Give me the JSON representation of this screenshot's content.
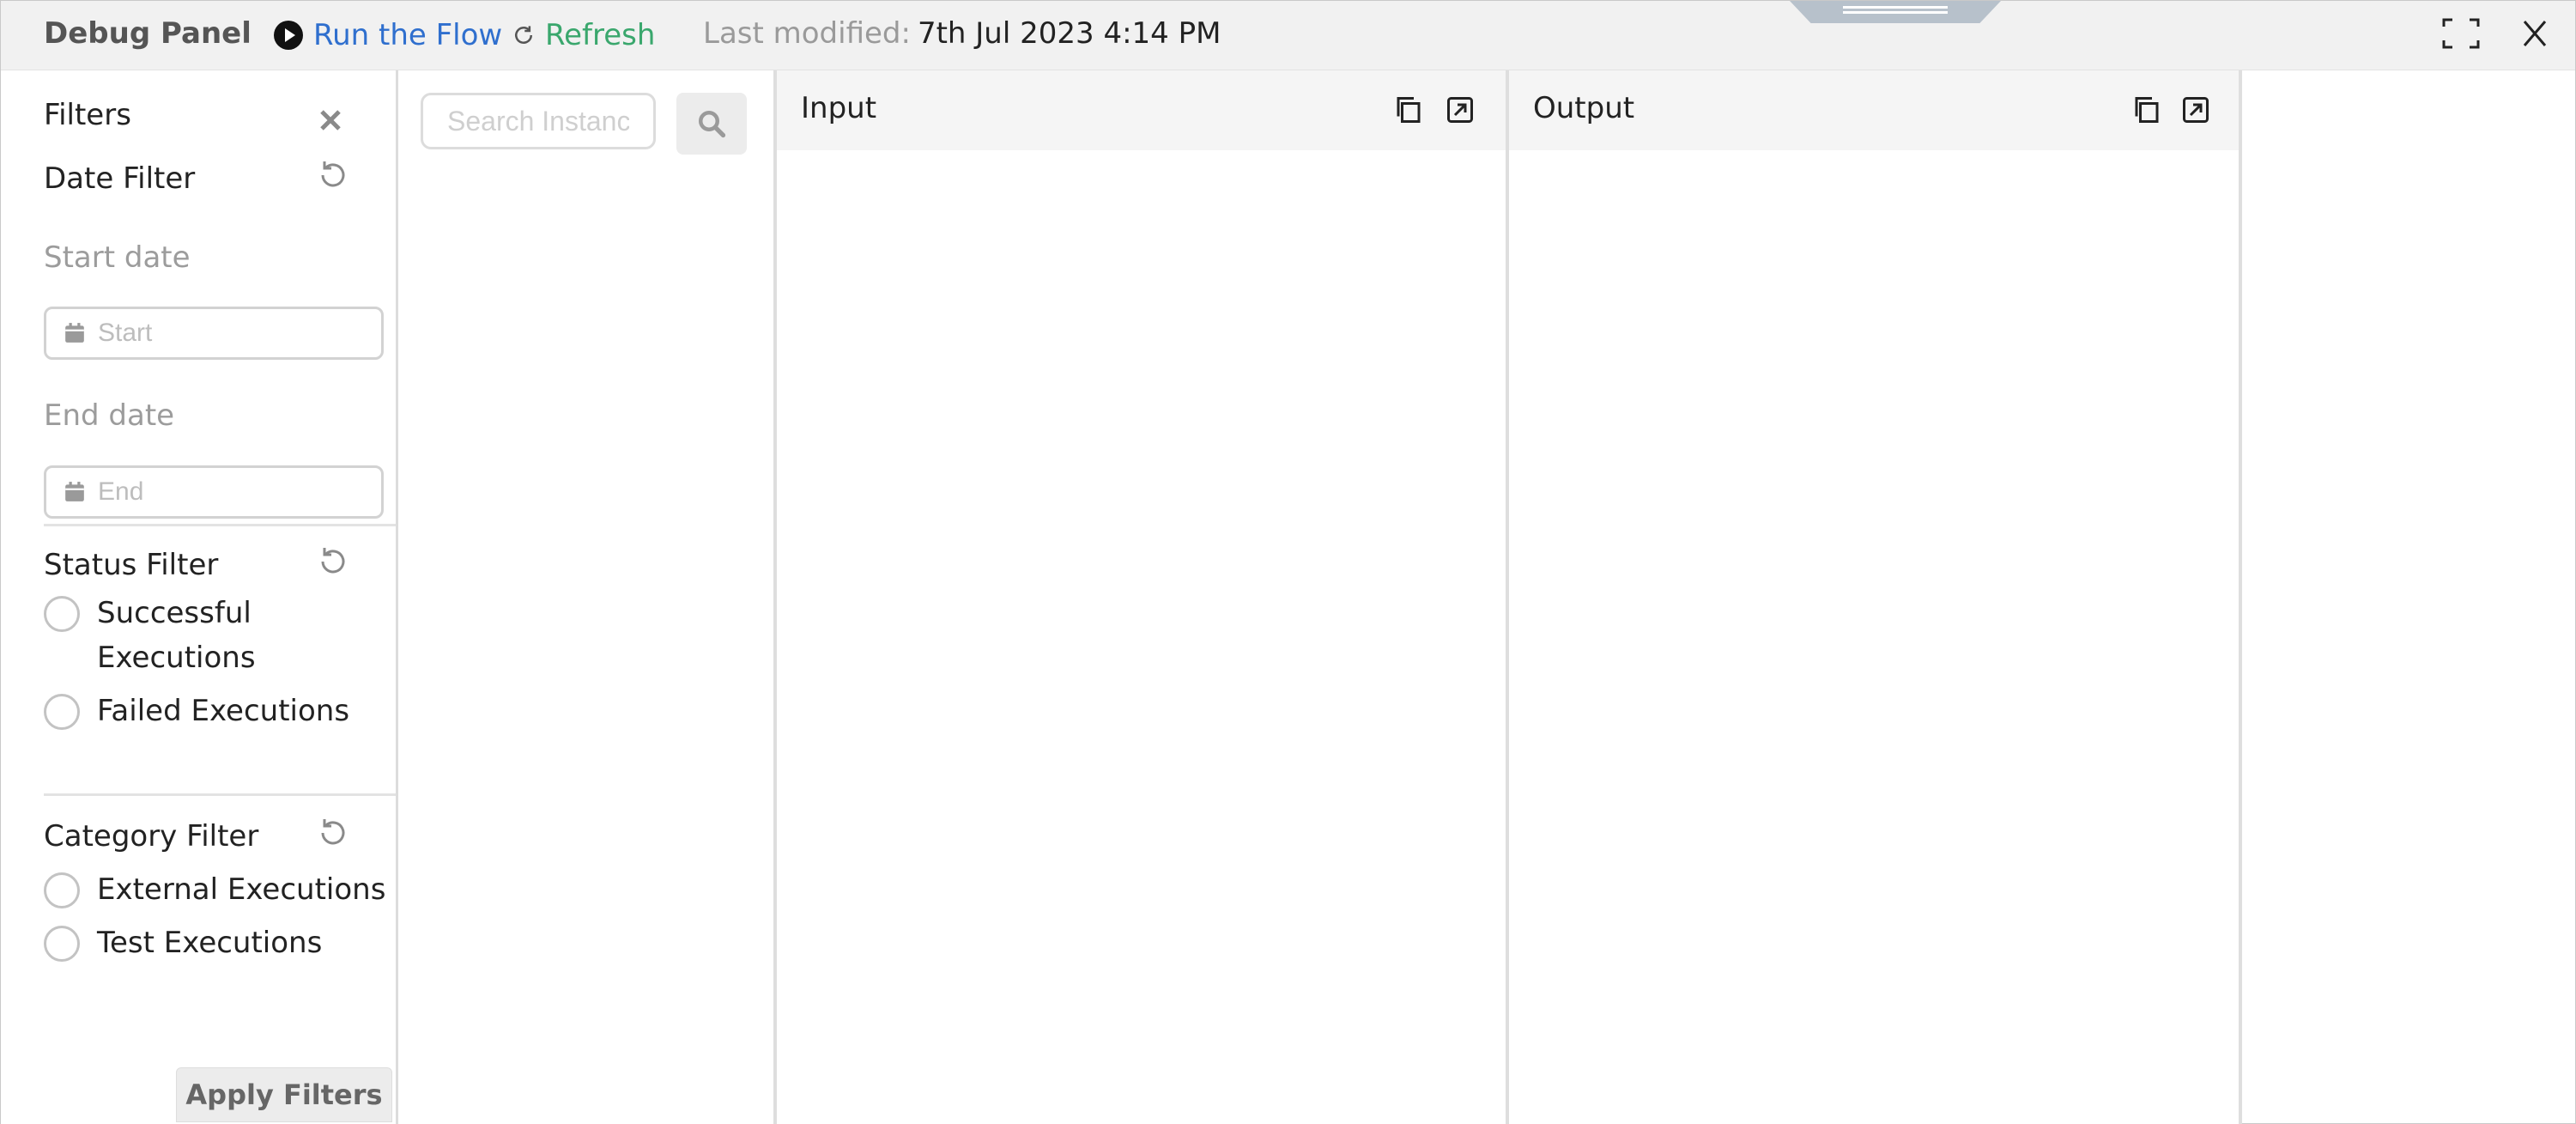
{
  "header": {
    "title": "Debug Panel",
    "run_label": "Run the Flow",
    "refresh_label": "Refresh",
    "last_modified_label": "Last modified:",
    "last_modified_value": "7th Jul 2023 4:14 PM"
  },
  "sidebar": {
    "title": "Filters",
    "date_filter": {
      "title": "Date Filter",
      "start_label": "Start date",
      "start_placeholder": "Start",
      "end_label": "End date",
      "end_placeholder": "End"
    },
    "status_filter": {
      "title": "Status Filter",
      "options": [
        "Successful Executions",
        "Failed Executions"
      ]
    },
    "category_filter": {
      "title": "Category Filter",
      "options": [
        "External Executions",
        "Test Executions"
      ]
    },
    "apply_label": "Apply Filters"
  },
  "search": {
    "placeholder": "Search Instances"
  },
  "panes": {
    "input_title": "Input",
    "output_title": "Output"
  },
  "colors": {
    "run_link": "#2f6fce",
    "refresh_link": "#3aa76d",
    "header_bg": "#f1f1f1",
    "muted_text": "#9a9a9a"
  },
  "icons": {
    "run": "play-circle-icon",
    "refresh": "refresh-icon",
    "fullscreen": "fullscreen-icon",
    "close": "close-icon",
    "reset": "reset-icon",
    "calendar": "calendar-icon",
    "search": "search-icon",
    "copy": "copy-icon",
    "expand": "expand-icon"
  }
}
